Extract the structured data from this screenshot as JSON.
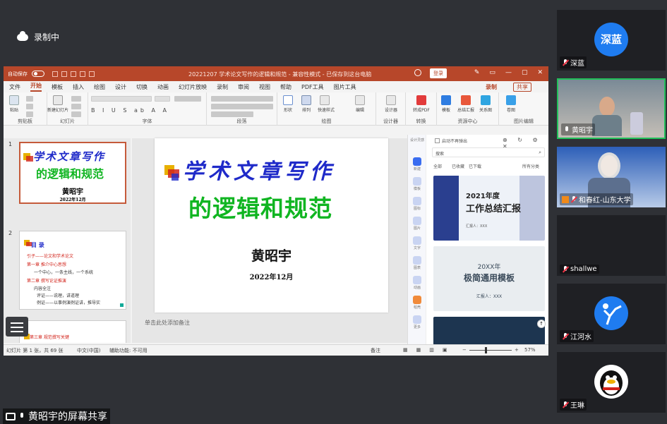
{
  "recording": {
    "label": "录制中"
  },
  "ppt": {
    "autosave_label": "自动保存",
    "window_title": "20221207 学术论文写作的逻辑和规范 - 兼容性模式 - 已保存到这台电脑",
    "login_label": "登录",
    "menu": [
      "文件",
      "开始",
      "模板",
      "插入",
      "绘图",
      "设计",
      "切换",
      "动画",
      "幻灯片放映",
      "录制",
      "审阅",
      "视图",
      "帮助",
      "PDF工具",
      "图片工具"
    ],
    "active_menu": "开始",
    "record_label": "录制",
    "share_label": "共享",
    "ribbon_groups": [
      "剪贴板",
      "幻灯片",
      "字体",
      "段落",
      "绘图",
      "设计器",
      "转换",
      "资源中心",
      "图片编辑"
    ],
    "ribbon_buttons": [
      "粘贴",
      "新建幻灯片",
      "形状",
      "排列",
      "快速样式",
      "编辑",
      "设计器",
      "转成PDF",
      "模板",
      "总结汇报",
      "关系图",
      "卷图"
    ],
    "slides": [
      {
        "number": "1",
        "title1": "学术文章写作",
        "title2": "的逻辑和规范",
        "author": "黄昭宇",
        "date": "2022年12月"
      },
      {
        "number": "2",
        "heading": "目  录",
        "items": [
          "引子——论文和学术论文",
          "第一章  推介中心思想",
          "一个中心，一条主线，一个系统",
          "第二章  撰写论证推演",
          "内容全注",
          "评证——说理，讲道理",
          "例证——以事例演例证讲，推导实"
        ]
      },
      {
        "number": "3",
        "heading": "第三章  规范撰写关键"
      }
    ],
    "main_slide": {
      "title1": "学术文章写作",
      "title2": "的逻辑和规范",
      "author": "黄昭宇",
      "date": "2022年12月"
    },
    "notes_placeholder": "单击此处添加备注",
    "panel": {
      "header": "设计灵感",
      "no_popup": "启动不再弹出",
      "search_placeholder": "搜索",
      "tabs": [
        "全部",
        "已收藏",
        "已下载"
      ],
      "all_categories": "所有分类",
      "templates": [
        {
          "year": "2021年度",
          "title": "工作总结汇报",
          "sub": "汇报人：XXX"
        },
        {
          "year": "20XX年",
          "title": "极简通用模板",
          "sub": "汇报人：XXX"
        }
      ],
      "sidebar_items": [
        "新建",
        "模板",
        "图标",
        "图片",
        "文字",
        "图表",
        "动画",
        "稻壳",
        "更多"
      ]
    },
    "status": {
      "slide_info": "幻灯片 第 1 张，共 69 张",
      "language": "中文(中国)",
      "accessibility": "辅助功能: 不可用",
      "notes_btn": "备注",
      "zoom": "57%"
    }
  },
  "participants": [
    {
      "name": "深蓝",
      "avatar_text": "深蓝",
      "avatar_color": "#1f7cf0",
      "muted": true
    },
    {
      "name": "黄昭宇",
      "muted": false,
      "speaking": true
    },
    {
      "name": "和春红-山东大学",
      "muted": true
    },
    {
      "name": "shallwe",
      "muted": true
    },
    {
      "name": "江河水",
      "muted": true
    },
    {
      "name": "王琳",
      "muted": true
    }
  ],
  "screen_share_label": "黄昭宇的屏幕共享",
  "colors": {
    "ppt_accent": "#b7472a",
    "slide_title_blue": "#1f2ac9",
    "slide_title_green": "#10b521",
    "active_speaker": "#21c15a"
  }
}
